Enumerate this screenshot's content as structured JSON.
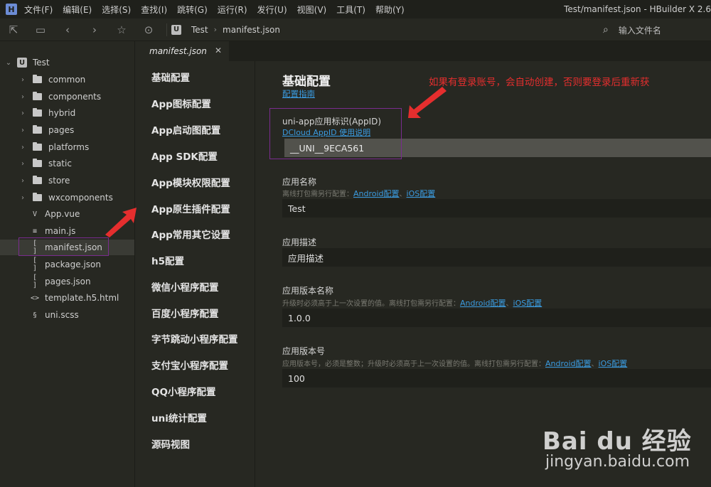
{
  "menubar": {
    "logo": "H",
    "items": [
      "文件(F)",
      "编辑(E)",
      "选择(S)",
      "查找(I)",
      "跳转(G)",
      "运行(R)",
      "发行(U)",
      "视图(V)",
      "工具(T)",
      "帮助(Y)"
    ],
    "window_title": "Test/manifest.json - HBuilder X 2.6"
  },
  "toolbar": {
    "breadcrumb_badge": "U",
    "breadcrumb": [
      "Test",
      "manifest.json"
    ],
    "file_search_placeholder": "输入文件名"
  },
  "project_tree": {
    "root": "Test",
    "items": [
      {
        "label": "common",
        "type": "folder"
      },
      {
        "label": "components",
        "type": "folder"
      },
      {
        "label": "hybrid",
        "type": "folder"
      },
      {
        "label": "pages",
        "type": "folder"
      },
      {
        "label": "platforms",
        "type": "folder"
      },
      {
        "label": "static",
        "type": "folder"
      },
      {
        "label": "store",
        "type": "folder"
      },
      {
        "label": "wxcomponents",
        "type": "folder"
      },
      {
        "label": "App.vue",
        "type": "vue",
        "glyph": "V"
      },
      {
        "label": "main.js",
        "type": "js",
        "glyph": "≡"
      },
      {
        "label": "manifest.json",
        "type": "json",
        "glyph": "[ ]",
        "selected": true
      },
      {
        "label": "package.json",
        "type": "json",
        "glyph": "[ ]"
      },
      {
        "label": "pages.json",
        "type": "json",
        "glyph": "[ ]"
      },
      {
        "label": "template.h5.html",
        "type": "html",
        "glyph": "<>"
      },
      {
        "label": "uni.scss",
        "type": "scss",
        "glyph": "§"
      }
    ]
  },
  "editor_tab": {
    "label": "manifest.json",
    "close": "✕"
  },
  "config_nav": [
    "基础配置",
    "App图标配置",
    "App启动图配置",
    "App SDK配置",
    "App模块权限配置",
    "App原生插件配置",
    "App常用其它设置",
    "h5配置",
    "微信小程序配置",
    "百度小程序配置",
    "字节跳动小程序配置",
    "支付宝小程序配置",
    "QQ小程序配置",
    "uni统计配置",
    "源码视图"
  ],
  "basic_config": {
    "title": "基础配置",
    "guide_link": "配置指南",
    "annotation": "如果有登录账号，会自动创建，否则要登录后重新获",
    "appid": {
      "label": "uni-app应用标识(AppID)",
      "help_link": "DCloud AppID 使用说明",
      "value": "__UNI__9ECA561"
    },
    "app_name": {
      "label": "应用名称",
      "hint": "离线打包需另行配置：",
      "link_android": "Android配置",
      "sep": "、",
      "link_ios": "iOS配置",
      "value": "Test"
    },
    "app_desc": {
      "label": "应用描述",
      "value": "应用描述"
    },
    "version_name": {
      "label": "应用版本名称",
      "hint": "升级时必须高于上一次设置的值。离线打包需另行配置：",
      "link_android": "Android配置",
      "sep": "、",
      "link_ios": "iOS配置",
      "value": "1.0.0"
    },
    "version_code": {
      "label": "应用版本号",
      "hint": "应用版本号，必须是整数；升级时必须高于上一次设置的值。离线打包需另行配置：",
      "link_android": "Android配置",
      "sep": "、",
      "link_ios": "iOS配置",
      "value": "100"
    }
  },
  "watermark": {
    "logo": "Bai du 经验",
    "url": "jingyan.baidu.com"
  }
}
